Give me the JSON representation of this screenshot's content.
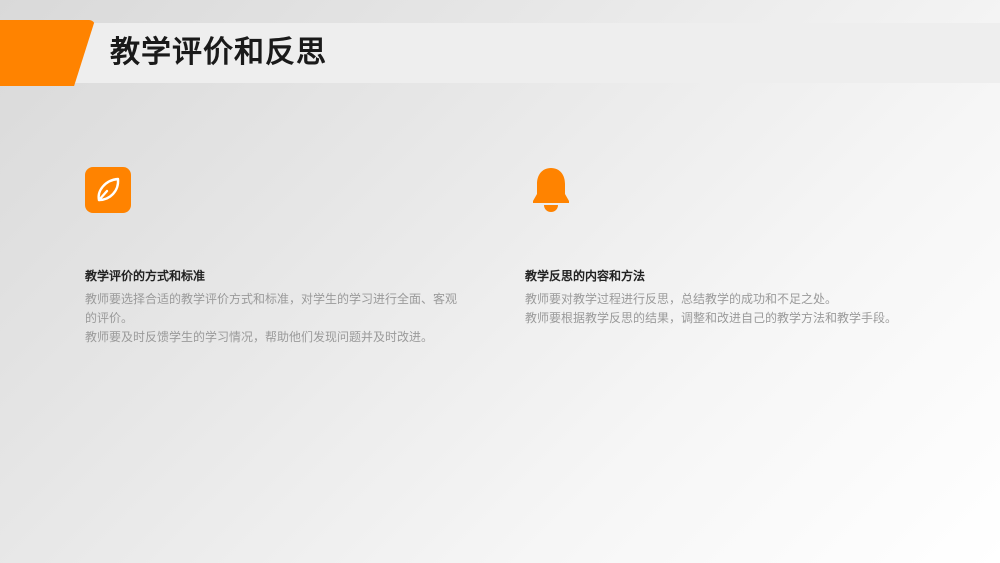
{
  "slide": {
    "title": "教学评价和反思",
    "accent_color": "#ff8300"
  },
  "sections": [
    {
      "icon": "leaf-icon",
      "heading": "教学评价的方式和标准",
      "lines": [
        "教师要选择合适的教学评价方式和标准，对学生的学习进行全面、客观",
        "的评价。",
        "教师要及时反馈学生的学习情况，帮助他们发现问题并及时改进。"
      ]
    },
    {
      "icon": "bell-icon",
      "heading": "教学反思的内容和方法",
      "lines": [
        "教师要对教学过程进行反思，总结教学的成功和不足之处。",
        "教师要根据教学反思的结果，调整和改进自己的教学方法和教学手段。"
      ]
    }
  ]
}
